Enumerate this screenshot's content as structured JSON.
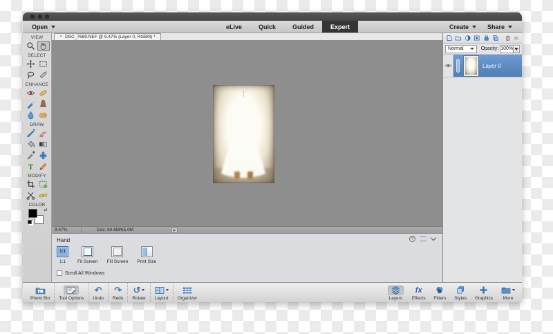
{
  "icons": {
    "undo": "↶",
    "redo": "↷",
    "rotate": "↺",
    "help": "?",
    "effects_fx": "fx",
    "type_tool": "T",
    "close_tab": "×",
    "adjustment": "◐",
    "swatch_reset": "⇄"
  },
  "menu_bar": {
    "open_label": "Open",
    "tabs": [
      {
        "label": "eLive",
        "active": false
      },
      {
        "label": "Quick",
        "active": false
      },
      {
        "label": "Guided",
        "active": false
      },
      {
        "label": "Expert",
        "active": true
      }
    ],
    "create_label": "Create",
    "share_label": "Share"
  },
  "doc_tab": {
    "title": "DSC_7689.NEF @ 9.47% (Layer 0, RGB/8) *"
  },
  "toolbar": {
    "sections": [
      {
        "label": "VIEW",
        "tools": [
          "zoom-tool",
          "hand-tool"
        ]
      },
      {
        "label": "SELECT",
        "tools": [
          "move-tool",
          "marquee-tool",
          "lasso-tool",
          "quick-selection-tool"
        ]
      },
      {
        "label": "ENHANCE",
        "tools": [
          "red-eye-tool",
          "spot-healing-tool",
          "smart-brush-tool",
          "clone-stamp-tool",
          "blur-tool",
          "sponge-tool"
        ]
      },
      {
        "label": "DRAW",
        "tools": [
          "brush-tool",
          "eraser-tool",
          "paint-bucket-tool",
          "gradient-tool",
          "eyedropper-tool",
          "shape-tool",
          "type-tool",
          "pencil-tool"
        ]
      },
      {
        "label": "MODIFY",
        "tools": [
          "crop-tool",
          "recompose-tool",
          "cookie-cutter-tool",
          "straighten-tool"
        ]
      },
      {
        "label": "COLOR",
        "tools": [
          "foreground-background-swatches"
        ]
      }
    ]
  },
  "statusbar": {
    "zoom_percent": "9.47%",
    "doc_size": "Doc: 60.6M/65.0M"
  },
  "tool_options": {
    "title": "Hand",
    "zoom_buttons": [
      {
        "label": "1:1",
        "icon_text": "1:1",
        "selected": true
      },
      {
        "label": "Fit Screen",
        "selected": false
      },
      {
        "label": "Fill Screen",
        "selected": false
      },
      {
        "label": "Print Size",
        "selected": false
      }
    ],
    "scroll_checkbox_label": "Scroll All Windows",
    "checkbox_checked": false
  },
  "taskbar": {
    "left": [
      {
        "label": "Photo Bin",
        "selected": false
      },
      {
        "label": "Tool Options",
        "selected": true
      },
      {
        "label": "Undo",
        "selected": false
      },
      {
        "label": "Redo",
        "selected": false
      },
      {
        "label": "Rotate",
        "selected": false,
        "has_menu": true
      },
      {
        "label": "Layout",
        "selected": false,
        "has_menu": true
      },
      {
        "label": "Organizer",
        "selected": false
      }
    ],
    "right": [
      {
        "label": "Layers",
        "selected": true
      },
      {
        "label": "Effects",
        "selected": false
      },
      {
        "label": "Filters",
        "selected": false
      },
      {
        "label": "Styles",
        "selected": false
      },
      {
        "label": "Graphics",
        "selected": false
      },
      {
        "label": "More",
        "selected": false,
        "has_menu": true
      }
    ]
  },
  "layers_panel": {
    "blend_mode": "Normal",
    "opacity_label": "Opacity:",
    "opacity_value": "100%",
    "layers": [
      {
        "name": "Layer 0",
        "visible": true,
        "selected": true
      }
    ]
  },
  "colors": {
    "accent_blue": "#3a76b8",
    "selected_layer_blue": "#5e8cc4",
    "canvas_gray": "#8e8e8e",
    "expert_tab_bg": "#353535"
  }
}
